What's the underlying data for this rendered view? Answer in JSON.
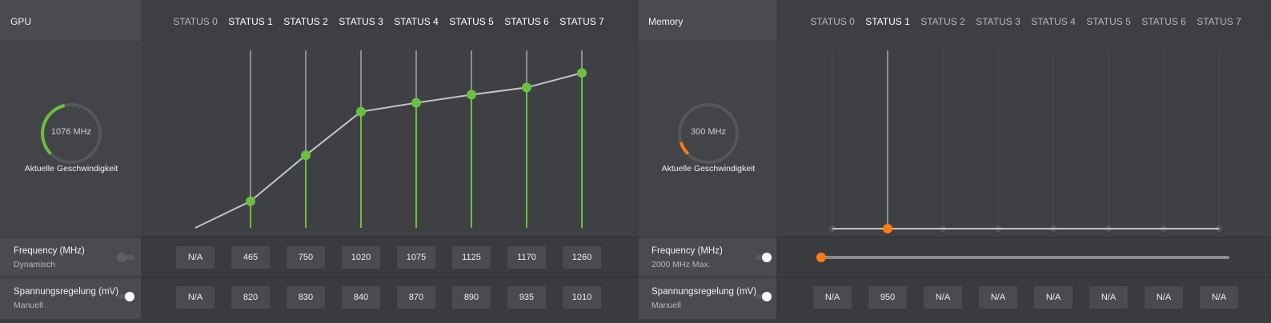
{
  "gpu": {
    "title": "GPU",
    "states": [
      "STATUS 0",
      "STATUS 1",
      "STATUS 2",
      "STATUS 3",
      "STATUS 4",
      "STATUS 5",
      "STATUS 6",
      "STATUS 7"
    ],
    "gauge_value": "1076 MHz",
    "gauge_fraction": 0.45,
    "gauge_caption": "Aktuelle Geschwindigkeit",
    "frequency_label": "Frequency (MHz)",
    "frequency_mode": "Dynamisch",
    "frequency_values": [
      "N/A",
      "465",
      "750",
      "1020",
      "1075",
      "1125",
      "1170",
      "1260"
    ],
    "voltage_label": "Spannungsregelung (mV)",
    "voltage_mode": "Manuell",
    "voltage_values": [
      "N/A",
      "820",
      "830",
      "840",
      "870",
      "890",
      "935",
      "1010"
    ]
  },
  "memory": {
    "title": "Memory",
    "states": [
      "STATUS 0",
      "STATUS 1",
      "STATUS 2",
      "STATUS 3",
      "STATUS 4",
      "STATUS 5",
      "STATUS 6",
      "STATUS 7"
    ],
    "gauge_value": "300 MHz",
    "gauge_fraction": 0.1,
    "gauge_caption": "Aktuelle Geschwindigkeit",
    "frequency_label": "Frequency (MHz)",
    "frequency_mode": "2000 MHz Max.",
    "slider_fraction": 0.0,
    "voltage_label": "Spannungsregelung (mV)",
    "voltage_mode": "Manuell",
    "voltage_values": [
      "N/A",
      "950",
      "N/A",
      "N/A",
      "N/A",
      "N/A",
      "N/A",
      "N/A"
    ]
  },
  "colors": {
    "gpu_accent": "#6cbf3f",
    "memory_accent": "#ff7a12"
  },
  "chart_data": [
    {
      "type": "line",
      "categories": [
        "STATUS 0",
        "STATUS 1",
        "STATUS 2",
        "STATUS 3",
        "STATUS 4",
        "STATUS 5",
        "STATUS 6",
        "STATUS 7"
      ],
      "series": [
        {
          "values": [
            null,
            465,
            750,
            1020,
            1075,
            1125,
            1170,
            1260
          ]
        }
      ],
      "ylim": [
        300,
        1400
      ]
    },
    {
      "type": "line",
      "categories": [
        "STATUS 0",
        "STATUS 1",
        "STATUS 2",
        "STATUS 3",
        "STATUS 4",
        "STATUS 5",
        "STATUS 6",
        "STATUS 7"
      ],
      "series": [
        {
          "values": [
            null,
            300,
            null,
            null,
            null,
            null,
            null,
            null
          ]
        }
      ],
      "ylim": [
        300,
        2000
      ]
    }
  ]
}
